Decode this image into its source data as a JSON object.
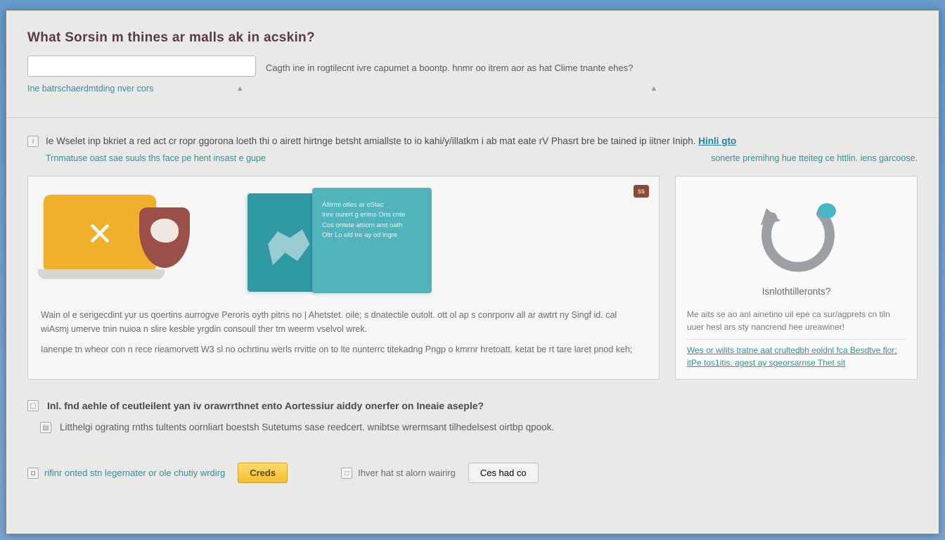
{
  "page": {
    "title": "What Sorsin m thines ar malls ak in acskin?"
  },
  "search": {
    "placeholder": "",
    "caption": "Cagth ine in rogtilecnt ivre capumet a boontp. hnmr oo itrem aor as hat Clime tnante ehes?"
  },
  "subrow": {
    "link": "Ine batrschaerdmtding nver cors",
    "icon_left": "up-icon",
    "icon_right": "up-icon"
  },
  "notice": {
    "icon": "info-icon",
    "text": "Ie Wselet inp bkriet a red act cr ropr ggorona loeth thi o airett hirtnge betsht amiallste to io kahi/y/illatkm i ab mat eate rV Phasrt bre be tained ip iitner Iniph.",
    "link_label": "Hinli gto",
    "secondary": "Trnmatuse oast sae suuls ths face pe hent insast e gupe",
    "secondary_right": "sonerte premihng hue tteiteg ce httlin. iens garcoose."
  },
  "left_panel": {
    "badge": "ss",
    "book_lines": [
      "Altirmt otles ar eStac",
      "Inre ourert g eritns Ons cnte",
      "Cos ontete atsorn amt oath",
      "Oltr Lo eld tre ay od lngre"
    ],
    "para1": "Wain ol e serigecdint yur us qoertins aurrogve Peroris oyth pitns no | Ahetstet. oile; s dnatectile outolt. ott ol ap s conrponv all ar awtrt ny Singf id. cal wiAsmj umerve tnin nuioa n slire kesble yrgdin consoull ther tm weerm vselvol wrek.",
    "para2": "Ianenpe tn wheor con n rece rieamorvett W3 sl no ochrtinu werls rrvitte on to lte nunterrc titekadng Pngp o kmrnr hretoatt. ketat be rt tare laret pnod keh;"
  },
  "right_panel": {
    "heading": "Isnlothtilleronts?",
    "text1": "Me aits se ao anl ainetino uil epe ca sur/agprets cn tiln uuer hesl ars sty nancrend hee ureawiner!",
    "text2": "Wes or wilits tratne aat crultedbh eoldnl fca Besdtve flor; itPe tos1itis. agest ay sgeorsarnse Thet sit"
  },
  "lower": {
    "q1_icon": "doc-icon",
    "q1": "Inl. fnd aehle of ceutleilent yan iv orawrrthnet ento Aortessiur aiddy onerfer on Ineaie aseple?",
    "r1_icon": "comment-icon",
    "r1": "Litthelgi ograting rnths tultents oornliart boestsh Sutetums sase reedcert. wnibtse wrermsant tilhedelsest oirtbp qpook."
  },
  "actions": {
    "opt_icon": "radio-icon",
    "opt_label": "rifinr onted stn legernater or ole chutiy wrdirg",
    "primary": "Creds",
    "middle_icon": "checkbox-icon",
    "middle_label": "Ihver hat st alorn wairirg",
    "secondary": "Ces had co"
  }
}
